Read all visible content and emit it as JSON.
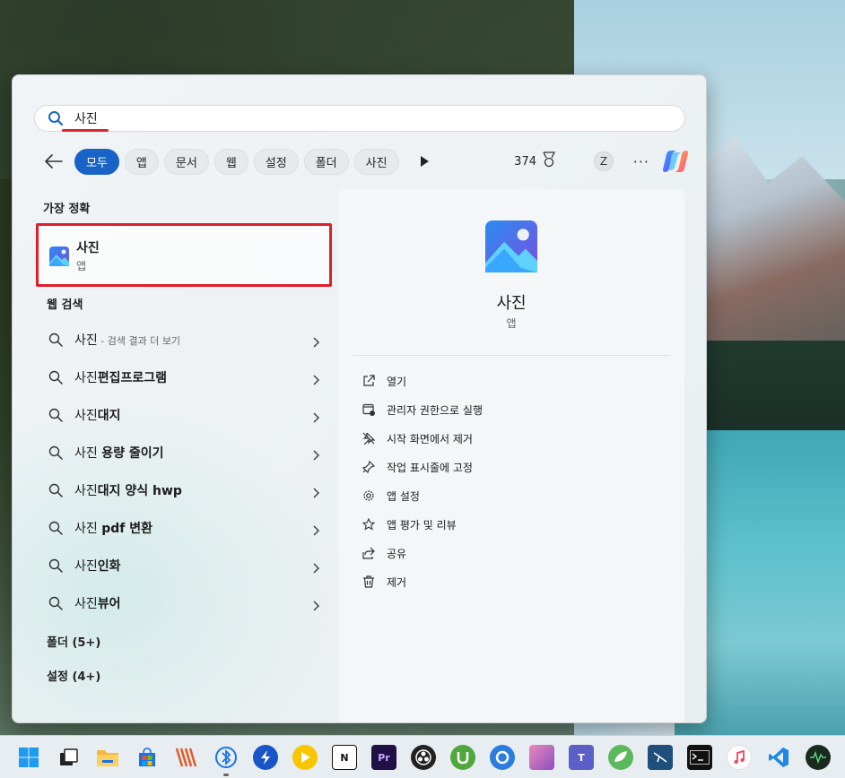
{
  "search": {
    "query": "사진"
  },
  "filters": {
    "chips": [
      "모두",
      "앱",
      "문서",
      "웹",
      "설정",
      "폴더",
      "사진"
    ],
    "points": "374",
    "avatar_letter": "Z",
    "more": "···"
  },
  "left": {
    "best_match_title": "가장 정확",
    "best_match": {
      "name": "사진",
      "type": "앱"
    },
    "web_title": "웹 검색",
    "web_items": [
      {
        "pre": "사진",
        "bold": "",
        "sub": " - 검색 결과 더 보기"
      },
      {
        "pre": "사진",
        "bold": "편집프로그램",
        "sub": ""
      },
      {
        "pre": "사진",
        "bold": "대지",
        "sub": ""
      },
      {
        "pre": "사진 ",
        "bold": "용량 줄이기",
        "sub": ""
      },
      {
        "pre": "사진",
        "bold": "대지 양식 hwp",
        "sub": ""
      },
      {
        "pre": "사진 ",
        "bold": "pdf 변환",
        "sub": ""
      },
      {
        "pre": "사진",
        "bold": "인화",
        "sub": ""
      },
      {
        "pre": "사진",
        "bold": "뷰어",
        "sub": ""
      }
    ],
    "folders": "폴더 (5+)",
    "settings": "설정 (4+)"
  },
  "detail": {
    "title": "사진",
    "subtitle": "앱",
    "actions": [
      {
        "label": "열기",
        "icon": "open-icon"
      },
      {
        "label": "관리자 권한으로 실행",
        "icon": "admin-run-icon"
      },
      {
        "label": "시작 화면에서 제거",
        "icon": "unpin-icon"
      },
      {
        "label": "작업 표시줄에 고정",
        "icon": "pin-icon"
      },
      {
        "label": "앱 설정",
        "icon": "gear-icon"
      },
      {
        "label": "앱 평가 및 리뷰",
        "icon": "star-icon"
      },
      {
        "label": "공유",
        "icon": "share-icon"
      },
      {
        "label": "제거",
        "icon": "trash-icon"
      }
    ]
  },
  "taskbar": {
    "icons": [
      "start-icon",
      "task-view-icon",
      "file-explorer-icon",
      "store-icon",
      "app-icon",
      "bluetooth-app-icon",
      "app-icon",
      "media-player-icon",
      "notion-icon",
      "premiere-icon",
      "obs-icon",
      "utorrent-icon",
      "app-icon",
      "app-icon",
      "teams-icon",
      "app-icon",
      "app-icon",
      "terminal-icon",
      "itunes-icon",
      "vscode-icon",
      "monitor-icon"
    ],
    "premiere_label": "Pr",
    "notion_label": "N",
    "teams_label": "T"
  }
}
